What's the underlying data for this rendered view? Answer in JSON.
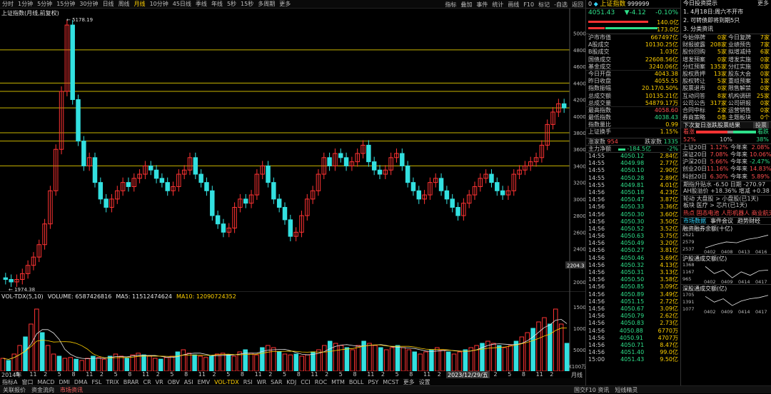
{
  "toolbar": {
    "periods": [
      "分时",
      "1分钟",
      "5分钟",
      "15分钟",
      "30分钟",
      "日线",
      "周线",
      "月线",
      "10分钟",
      "45日线",
      "季线",
      "年线",
      "5秒",
      "15秒",
      "多周期",
      "更多"
    ],
    "active_period": "月线",
    "tools": [
      "指标",
      "叠加",
      "事件",
      "统计",
      "画线",
      "F10",
      "标记",
      "-自选",
      "返回"
    ]
  },
  "chart": {
    "title": "上证指数(月线,前复权)",
    "high_label": "5178.19",
    "low_label": "1974.38",
    "last_badge": "2204.3",
    "y_ticks": [
      "5000",
      "4800",
      "4600",
      "4400",
      "4200",
      "4000",
      "3800",
      "3600",
      "3400",
      "3200",
      "3000",
      "2800",
      "2600",
      "2400",
      "2200",
      "2000"
    ]
  },
  "volume": {
    "legend_name": "VOL-TDX(5,10)",
    "legend_volume": "VOLUME: 6587426816",
    "legend_ma5": "MA5: 11512474624",
    "legend_ma10": "MA10: 12090724352",
    "y_ticks": [
      "15000",
      "10000",
      "5000"
    ],
    "unit": "X100万"
  },
  "x_axis": {
    "labels": [
      "2014年",
      "8",
      "11",
      "2",
      "5",
      "8",
      "11",
      "2",
      "5",
      "8",
      "11",
      "2",
      "5",
      "8",
      "11",
      "2",
      "5",
      "8",
      "11",
      "2",
      "5",
      "8",
      "11",
      "2",
      "5",
      "8",
      "11",
      "2",
      "5",
      "8",
      "11",
      "2",
      "5",
      "8",
      "11",
      "2",
      "5",
      "8",
      "11",
      "2"
    ],
    "cursor_date": "2023/12/29/五",
    "right_label": "月线"
  },
  "indicators": [
    "指标A",
    "窗口",
    "MACD",
    "DMI",
    "DMA",
    "FSL",
    "TRIX",
    "BRAR",
    "CR",
    "VR",
    "OBV",
    "ASI",
    "EMV",
    "VOL-TDX",
    "RSI",
    "WR",
    "SAR",
    "KDJ",
    "CCI",
    "ROC",
    "MTM",
    "BOLL",
    "PSY",
    "MCST",
    "更多",
    "设置"
  ],
  "active_indicator": "VOL-TDX",
  "bottom_tabs": [
    "关联报价",
    "资金流向",
    "市场资讯"
  ],
  "status": {
    "left": "国交F10 资讯",
    "right": "短线精灵"
  },
  "quote": {
    "number": "0",
    "name": "上证指数",
    "code": "999999",
    "price": "4051.43",
    "change": "▼-4.12",
    "pct": "-0.10%",
    "vol_buy": "140.0亿",
    "vol_sell": "173.0亿",
    "rows": [
      [
        "沪市市值",
        "667497亿"
      ],
      [
        "A股成交",
        "10130.25亿"
      ],
      [
        "B股成交",
        "1.03亿"
      ],
      [
        "国债成交",
        "22608.56亿"
      ],
      [
        "基金成交",
        "3240.06亿"
      ],
      [
        "今日开盘",
        "4043.38"
      ],
      [
        "昨日收盘",
        "4055.55"
      ],
      [
        "指数振幅",
        "20.17/0.50%"
      ],
      [
        "总成交额",
        "10135.21亿"
      ],
      [
        "总成交量",
        "54879.17万"
      ],
      [
        "最高指数",
        "4058.60"
      ],
      [
        "最低指数",
        "4038.43"
      ],
      [
        "指数量比",
        "0.99"
      ],
      [
        "上证换手",
        "1.15%"
      ]
    ],
    "updown_label_up": "涨家数",
    "updown_up": "954",
    "updown_label_down": "跌家数",
    "updown_down": "1335",
    "flow_label": "主力净额",
    "flow_value": "-184.5亿",
    "flow_pct": "-2%"
  },
  "ticks": [
    [
      "14:55",
      "4050.12",
      "2.84亿"
    ],
    [
      "14:55",
      "4049.98",
      "2.77亿"
    ],
    [
      "14:55",
      "4050.10",
      "2.90亿"
    ],
    [
      "14:55",
      "4050.28",
      "2.89亿"
    ],
    [
      "14:55",
      "4049.81",
      "4.01亿"
    ],
    [
      "14:56",
      "4050.18",
      "4.23亿"
    ],
    [
      "14:56",
      "4050.47",
      "3.87亿"
    ],
    [
      "14:56",
      "4050.33",
      "3.36亿"
    ],
    [
      "14:56",
      "4050.30",
      "3.60亿"
    ],
    [
      "14:56",
      "4050.30",
      "3.50亿"
    ],
    [
      "14:56",
      "4050.52",
      "3.52亿"
    ],
    [
      "14:56",
      "4050.63",
      "3.75亿"
    ],
    [
      "14:56",
      "4050.49",
      "3.20亿"
    ],
    [
      "14:56",
      "4050.27",
      "3.81亿"
    ],
    [
      "14:56",
      "4050.46",
      "3.69亿"
    ],
    [
      "14:56",
      "4050.32",
      "4.13亿"
    ],
    [
      "14:56",
      "4050.31",
      "3.13亿"
    ],
    [
      "14:56",
      "4050.50",
      "3.58亿"
    ],
    [
      "14:56",
      "4050.85",
      "3.09亿"
    ],
    [
      "14:56",
      "4050.89",
      "3.49亿"
    ],
    [
      "14:56",
      "4051.15",
      "2.72亿"
    ],
    [
      "14:56",
      "4050.67",
      "3.09亿"
    ],
    [
      "14:56",
      "4050.79",
      "2.62亿"
    ],
    [
      "14:56",
      "4050.83",
      "2.73亿"
    ],
    [
      "14:56",
      "4050.88",
      "6770万"
    ],
    [
      "14:56",
      "4050.91",
      "4707万"
    ],
    [
      "14:56",
      "4050.71",
      "8.47亿"
    ],
    [
      "14:56",
      "4051.40",
      "99.0亿"
    ],
    [
      "15:00",
      "4051.43",
      "9.50亿"
    ]
  ],
  "news": {
    "title": "今日投资提示",
    "more": "更多",
    "items": [
      "1. 4月18日:周六不开市",
      "2. 可转债即将到期5只",
      "3. 分类资讯"
    ]
  },
  "events": [
    [
      "今始停牌",
      "0家",
      "今日复牌",
      "7家"
    ],
    [
      "财报披露",
      "208家",
      "业绩预告",
      "7家"
    ],
    [
      "股份回购",
      "5家",
      "拟增减持",
      "6家"
    ],
    [
      "增发预案",
      "0家",
      "增发实施",
      "0家"
    ],
    [
      "分红预案",
      "135家",
      "分红实施",
      "0家"
    ],
    [
      "股权质押",
      "13家",
      "股东大会",
      "0家"
    ],
    [
      "股权转让",
      "5家",
      "重组预案",
      "1家"
    ],
    [
      "股票退市",
      "0家",
      "限售解禁",
      "0家"
    ],
    [
      "互动问答",
      "8家",
      "机构调研",
      "25家"
    ],
    [
      "公司公告",
      "317家",
      "公司研报",
      "0家"
    ],
    [
      "合同中标",
      "2家",
      "运营销售",
      "0家"
    ],
    [
      "券商策略",
      "0条",
      "主题板块",
      "0个"
    ]
  ],
  "stats": {
    "title": "下次复日涨跌股票结果",
    "btn": "投票",
    "left": "看涨",
    "right": "看跌",
    "p1": "52%",
    "p2": "10%",
    "p3": "38%",
    "rows": [
      [
        "上证20日",
        "1.12%",
        "今年来",
        "2.08%"
      ],
      [
        "深证20日",
        "7.08%",
        "今年来",
        "10.06%"
      ],
      [
        "沪深20日",
        "5.66%",
        "今年来",
        "-2.47%"
      ],
      [
        "创业20日",
        "11.16%",
        "今年来",
        "14.83%"
      ],
      [
        "科创20日",
        "6.30%",
        "今年来",
        "5.89%"
      ]
    ],
    "future": "期指升贴水 -6.50 日期 -270.97",
    "ah": "AH股溢价 +18.36% 增减 +0.38",
    "rot1": "轮动 大盘股 > 小盘股(已1天)",
    "rot2": "板块 医疗 > 芯片(已1天)",
    "hot": "热点 固态电池 人形机器人 商业航天"
  },
  "mini_tabs": [
    "市场数据",
    "事件会议",
    "趋势财经"
  ],
  "mini_charts": [
    {
      "title": "融资融券余额(十亿)",
      "y": [
        "2621",
        "2579",
        "2537"
      ],
      "x": [
        "0402",
        "0408",
        "0413",
        "0416"
      ],
      "values": [
        2540,
        2560,
        2575,
        2570,
        2590,
        2600,
        2615
      ]
    },
    {
      "title": "沪股通成交额(亿)",
      "y": [
        "1368",
        "1167",
        "965"
      ],
      "x": [
        "0402",
        "0409",
        "0414",
        "0417"
      ],
      "values": [
        1300,
        1100,
        1200,
        980,
        1150,
        1050,
        1180,
        1200
      ]
    },
    {
      "title": "深股通成交额(亿)",
      "y": [
        "1705",
        "1391",
        "1077"
      ],
      "x": [
        "0402",
        "0409",
        "0414",
        "0417"
      ],
      "values": [
        1600,
        1350,
        1500,
        1200,
        1400,
        1500,
        1550,
        1650
      ]
    }
  ]
}
